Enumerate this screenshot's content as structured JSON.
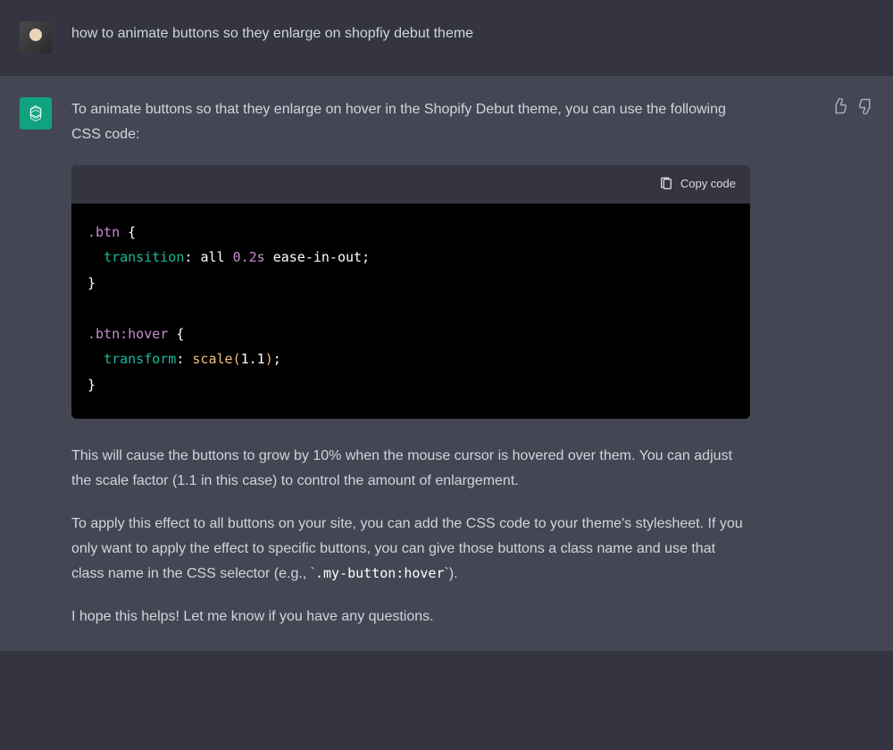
{
  "user": {
    "message": "how to animate buttons so they enlarge on shopfiy debut theme"
  },
  "assistant": {
    "intro": "To animate buttons so that they enlarge on hover in the Shopify Debut theme, you can use the following CSS code:",
    "copy_label": "Copy code",
    "code": {
      "rule1_selector": ".btn",
      "rule1_prop": "transition",
      "rule1_val_kw1": "all",
      "rule1_val_num": "0.2s",
      "rule1_val_kw2": "ease-in-out",
      "rule2_selector": ".btn:hover",
      "rule2_prop": "transform",
      "rule2_func": "scale",
      "rule2_arg": "1.1"
    },
    "para1": "This will cause the buttons to grow by 10% when the mouse cursor is hovered over them. You can adjust the scale factor (1.1 in this case) to control the amount of enlargement.",
    "para2_a": "To apply this effect to all buttons on your site, you can add the CSS code to your theme's stylesheet. If you only want to apply the effect to specific buttons, you can give those buttons a class name and use that class name in the CSS selector (e.g., `",
    "para2_code": ".my-button:hover",
    "para2_b": "`).",
    "para3": "I hope this helps! Let me know if you have any questions."
  }
}
